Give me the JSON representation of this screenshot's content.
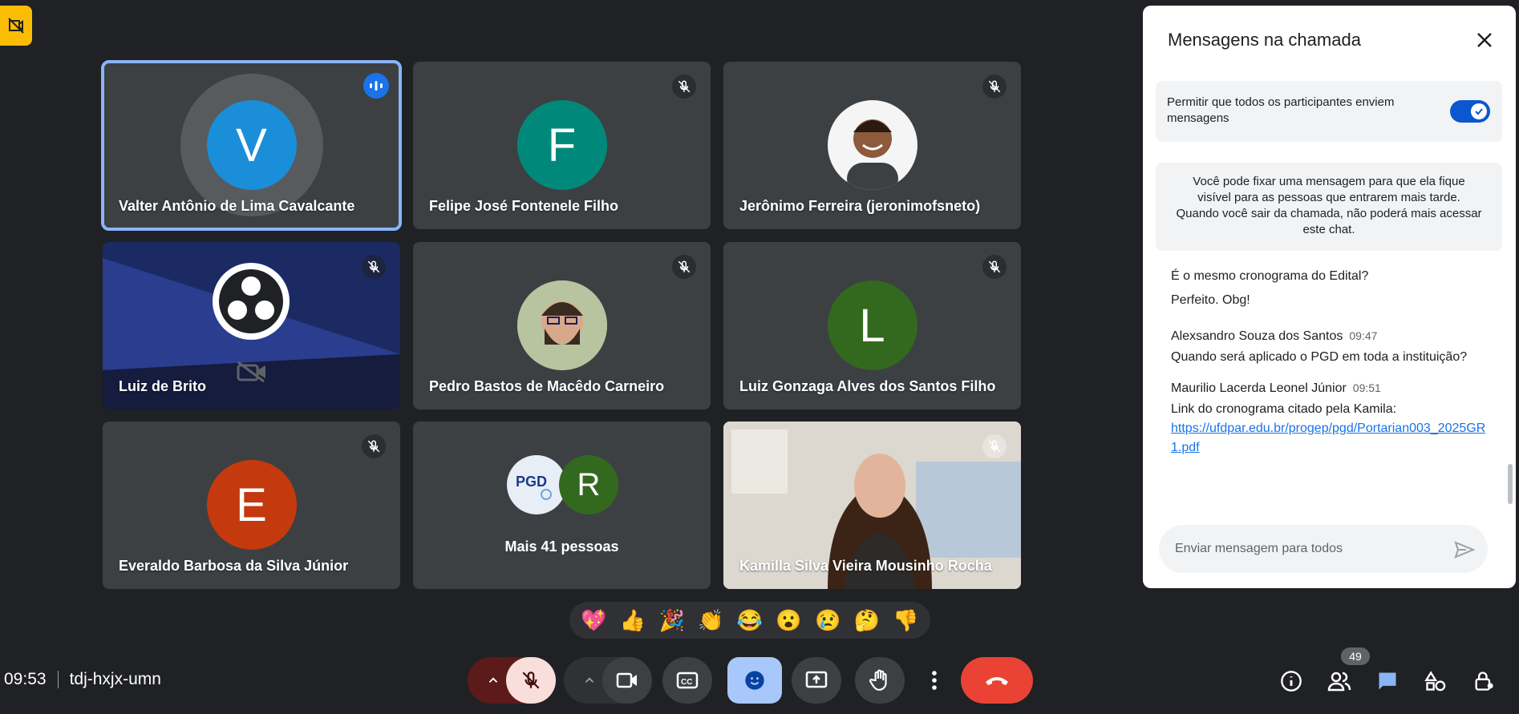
{
  "tiles": [
    {
      "name": "Valter Antônio de Lima Cavalcante",
      "initial": "V",
      "color": "#1a8ed8"
    },
    {
      "name": "Felipe José Fontenele Filho",
      "initial": "F",
      "color": "#00897b"
    },
    {
      "name": "Jerônimo Ferreira (jeronimofsneto)"
    },
    {
      "name": "Luiz de Brito"
    },
    {
      "name": "Pedro Bastos de Macêdo Carneiro"
    },
    {
      "name": "Luiz Gonzaga Alves dos Santos Filho",
      "initial": "L",
      "color": "#33691e"
    },
    {
      "name": "Everaldo Barbosa da Silva Júnior",
      "initial": "E",
      "color": "#c4390d"
    },
    {
      "name": "Mais 41 pessoas",
      "initial": "R",
      "color": "#33691e"
    },
    {
      "name": "Kamilla Silva Vieira Mousinho Rocha"
    }
  ],
  "reactions": [
    "💖",
    "👍",
    "🎉",
    "👏",
    "😂",
    "😮",
    "😢",
    "🤔",
    "👎"
  ],
  "meeting": {
    "time": "09:53",
    "code": "tdj-hxjx-umn"
  },
  "people_count": "49",
  "panel": {
    "title": "Mensagens na chamada",
    "toggle_label": "Permitir que todos os participantes enviem mensagens",
    "info": "Você pode fixar uma mensagem para que ela fique visível para as pessoas que entrarem mais tarde. Quando você sair da chamada, não poderá mais acessar este chat.",
    "messages": [
      {
        "text": "É o mesmo cronograma do Edital?"
      },
      {
        "text": "Perfeito. Obg!"
      },
      {
        "sender": "Alexsandro Souza dos Santos",
        "time": "09:47",
        "text": "Quando será aplicado o PGD em toda a instituição?"
      },
      {
        "sender": "Maurilio Lacerda Leonel Júnior",
        "time": "09:51",
        "text": "Link do cronograma citado pela Kamila:",
        "link": "https://ufdpar.edu.br/progep/pgd/Portarian003_2025GR1.pdf"
      }
    ],
    "input_placeholder": "Enviar mensagem para todos"
  },
  "colors": {
    "accent": "#1a73e8",
    "hangup": "#ea4335",
    "mic_off": "#f9dedc",
    "reaction_active": "#a8c7fa"
  }
}
